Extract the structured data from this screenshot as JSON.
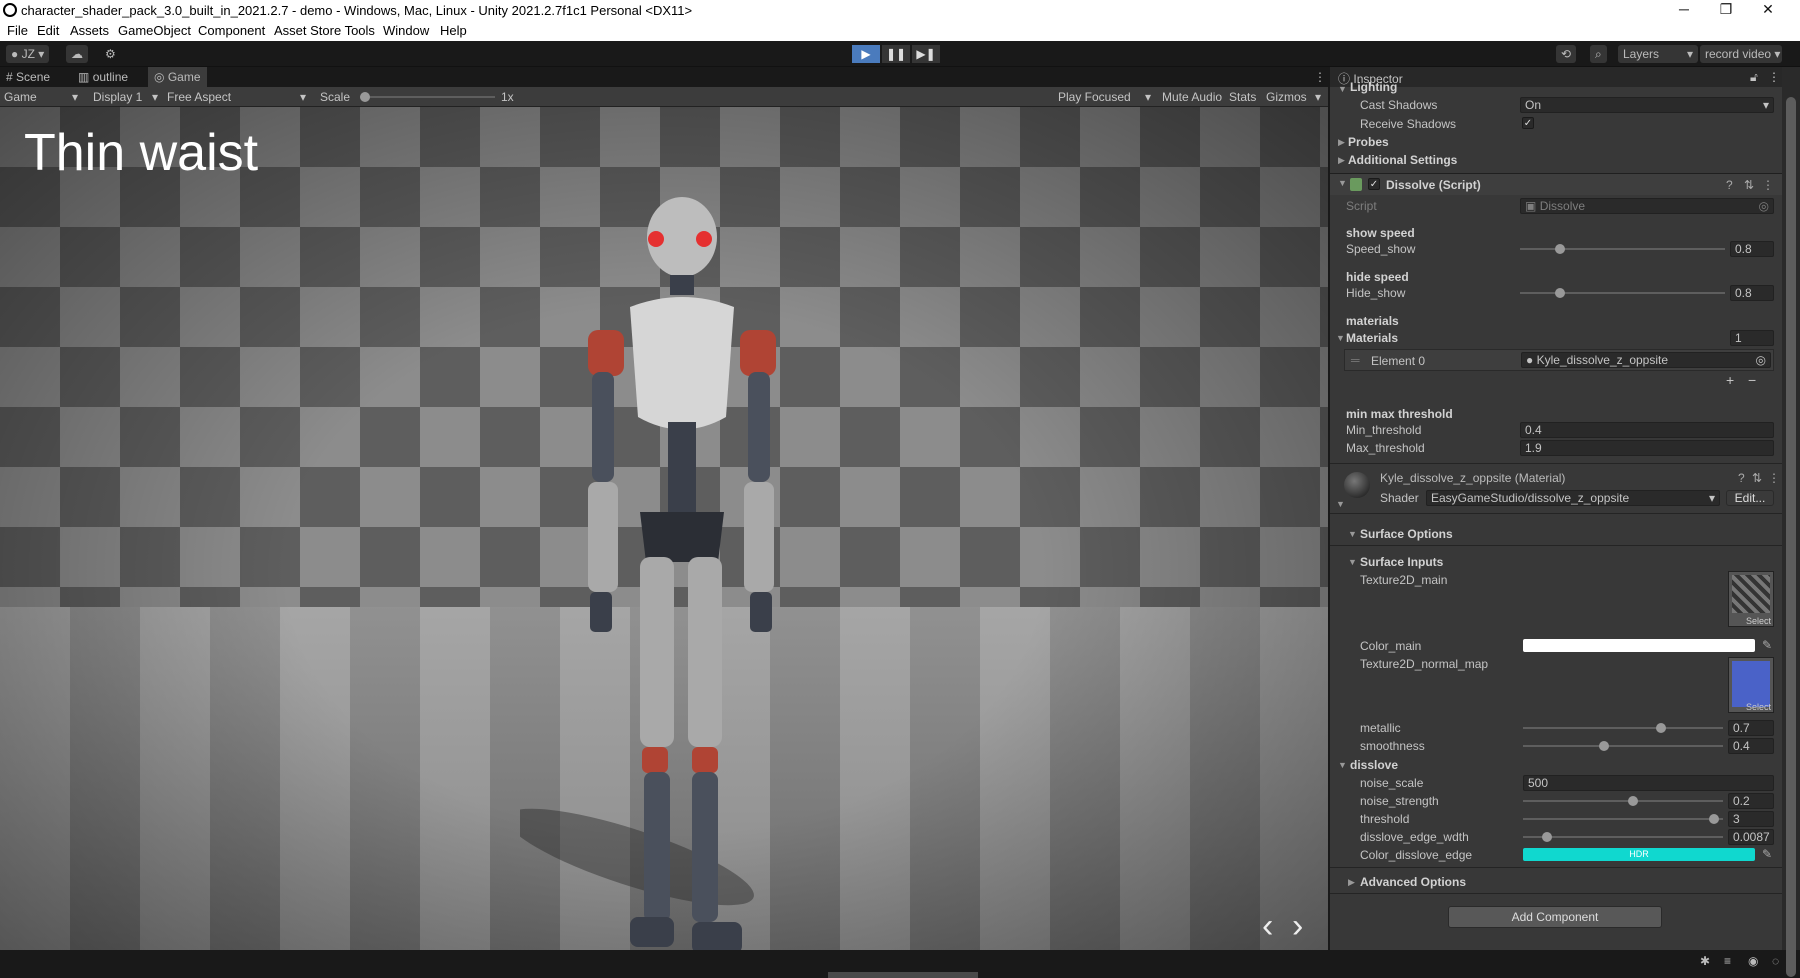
{
  "window": {
    "title": "character_shader_pack_3.0_built_in_2021.2.7 - demo - Windows, Mac, Linux - Unity 2021.2.7f1c1 Personal <DX11>",
    "minimize": "─",
    "maximize": "❐",
    "close": "✕"
  },
  "menu": [
    "File",
    "Edit",
    "Assets",
    "GameObject",
    "Component",
    "Asset Store Tools",
    "Window",
    "Help"
  ],
  "toolbar": {
    "account": "JZ",
    "layers": "Layers",
    "layout": "record video"
  },
  "tabs": {
    "scene": "Scene",
    "outline": "outline",
    "game": "Game",
    "inspector": "Inspector"
  },
  "gamebar": {
    "mode": "Game",
    "display": "Display 1",
    "aspect": "Free Aspect",
    "scale_label": "Scale",
    "scale_value": "1x",
    "play_focused": "Play Focused",
    "mute": "Mute Audio",
    "stats": "Stats",
    "gizmos": "Gizmos"
  },
  "viewport": {
    "caption": "Thin waist"
  },
  "inspector": {
    "lighting": "Lighting",
    "cast_shadows_label": "Cast Shadows",
    "cast_shadows_value": "On",
    "receive_shadows_label": "Receive Shadows",
    "probes": "Probes",
    "additional": "Additional Settings",
    "dissolve_title": "Dissolve (Script)",
    "script_label": "Script",
    "script_value": "Dissolve",
    "show_speed_hdr": "show speed",
    "speed_show_label": "Speed_show",
    "speed_show_value": "0.8",
    "hide_speed_hdr": "hide speed",
    "hide_show_label": "Hide_show",
    "hide_show_value": "0.8",
    "materials_hdr": "materials",
    "materials_label": "Materials",
    "materials_count": "1",
    "element0_label": "Element 0",
    "element0_value": "Kyle_dissolve_z_oppsite",
    "plus": "+",
    "minus": "−",
    "threshold_hdr": "min max threshold",
    "min_label": "Min_threshold",
    "min_value": "0.4",
    "max_label": "Max_threshold",
    "max_value": "1.9",
    "material_title": "Kyle_dissolve_z_oppsite (Material)",
    "shader_label": "Shader",
    "shader_value": "EasyGameStudio/dissolve_z_oppsite",
    "edit": "Edit...",
    "surface_options": "Surface Options",
    "surface_inputs": "Surface Inputs",
    "tex_main": "Texture2D_main",
    "select": "Select",
    "color_main": "Color_main",
    "tex_normal": "Texture2D_normal_map",
    "metallic_label": "metallic",
    "metallic_value": "0.7",
    "smooth_label": "smoothness",
    "smooth_value": "0.4",
    "dissolve_hdr": "disslove",
    "noise_scale_label": "noise_scale",
    "noise_scale_value": "500",
    "noise_strength_label": "noise_strength",
    "noise_strength_value": "0.2",
    "threshold_label": "threshold",
    "threshold_value": "3",
    "edge_width_label": "disslove_edge_wdth",
    "edge_width_value": "0.0087",
    "edge_color_label": "Color_disslove_edge",
    "hdr": "HDR",
    "advanced": "Advanced Options",
    "add_component": "Add Component"
  },
  "sliders": {
    "speed_show": 0.18,
    "hide_show": 0.18,
    "scale": 0.0,
    "metallic": 0.7,
    "smoothness": 0.4,
    "noise_strength": 0.55,
    "threshold": 0.98,
    "edge_width": 0.1
  },
  "colors": {
    "accent": "#4a7bbd",
    "edge_color": "#10d8cf",
    "color_main": "#ffffff",
    "normal_map": "#4a62c8"
  }
}
